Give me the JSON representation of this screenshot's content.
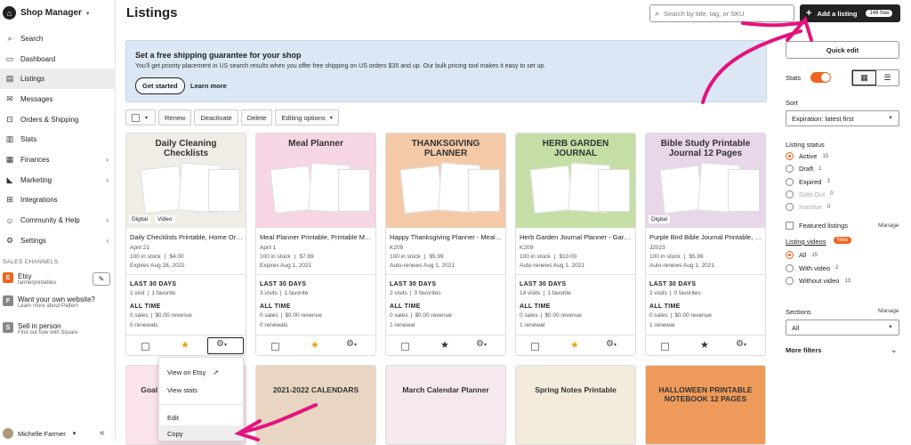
{
  "sidebar": {
    "app_name": "Shop Manager",
    "items": [
      {
        "label": "Search",
        "icon": "search-icon",
        "glyph": "⌕"
      },
      {
        "label": "Dashboard",
        "icon": "dashboard-icon",
        "glyph": "▭"
      },
      {
        "label": "Listings",
        "icon": "listings-icon",
        "glyph": "▤",
        "active": true
      },
      {
        "label": "Messages",
        "icon": "messages-icon",
        "glyph": "✉"
      },
      {
        "label": "Orders & Shipping",
        "icon": "orders-icon",
        "glyph": "⊡"
      },
      {
        "label": "Stats",
        "icon": "stats-icon",
        "glyph": "▥"
      },
      {
        "label": "Finances",
        "icon": "finances-icon",
        "glyph": "▦",
        "chevron": true
      },
      {
        "label": "Marketing",
        "icon": "marketing-icon",
        "glyph": "◣",
        "chevron": true
      },
      {
        "label": "Integrations",
        "icon": "integrations-icon",
        "glyph": "⊞"
      },
      {
        "label": "Community & Help",
        "icon": "community-icon",
        "glyph": "☺",
        "chevron": true
      },
      {
        "label": "Settings",
        "icon": "settings-icon",
        "glyph": "⚙",
        "chevron": true
      }
    ],
    "sales_channels_label": "SALES CHANNELS",
    "channels": [
      {
        "badge": "E",
        "color": "#f1641e",
        "title": "Etsy",
        "sub": "farmerprintables"
      },
      {
        "badge": "F",
        "color": "#888888",
        "title": "Want your own website?",
        "sub": "Learn more about Pattern"
      },
      {
        "badge": "S",
        "color": "#888888",
        "title": "Sell in person",
        "sub": "Find out how with Square"
      }
    ],
    "edit_glyph": "✎",
    "user_name": "Michelle Farmer",
    "user_caret": "▾",
    "collapse_glyph": "«"
  },
  "header": {
    "title": "Listings",
    "search_placeholder": "Search by title, tag, or SKU",
    "add_label": "Add a listing",
    "add_badge": "146 free"
  },
  "banner": {
    "heading": "Set a free shipping guarantee for your shop",
    "text": "You'll get priority placement in US search results when you offer free shipping on US orders $35 and up. Our bulk pricing tool makes it easy to set up.",
    "primary": "Get started",
    "secondary": "Learn more"
  },
  "toolbar": {
    "renew": "Renew",
    "deactivate": "Deactivate",
    "delete": "Delete",
    "editing": "Editing options"
  },
  "labels": {
    "last30": "LAST 30 DAYS",
    "alltime": "ALL TIME"
  },
  "listings": [
    {
      "title": "Daily Checklists Printable, Home Organization",
      "date": "April 21",
      "stock": "100 in stock",
      "price": "$4.00",
      "renew": "Expires Aug 28, 2021",
      "visits": "1 visit",
      "fav": "1 favorite",
      "sales": "0 sales",
      "revenue": "$0.00 revenue",
      "renewals": "0 renewals",
      "starred": true,
      "tags": [
        "Digital",
        "Video"
      ],
      "bg": "#f0ece6",
      "img_text": "Daily Cleaning Checklists"
    },
    {
      "title": "Meal Planner Printable, Printable Meal Planner",
      "date": "April 1",
      "stock": "100 in stock",
      "price": "$7.99",
      "renew": "Expires Aug 1, 2021",
      "visits": "3 visits",
      "fav": "1 favorite",
      "sales": "0 sales",
      "revenue": "$0.00 revenue",
      "renewals": "0 renewals",
      "starred": true,
      "tags": [],
      "bg": "#f6d5e4",
      "img_text": "Meal Planner"
    },
    {
      "title": "Happy Thanksgiving Planner - Meal Planning",
      "date": "K209",
      "stock": "100 in stock",
      "price": "$5.99",
      "renew": "Auto-renews Aug 1, 2021",
      "visits": "2 visits",
      "fav": "0 favorites",
      "sales": "0 sales",
      "revenue": "$0.00 revenue",
      "renewals": "1 renewal",
      "starred": false,
      "tags": [],
      "bg": "#f3c9a8",
      "img_text": "THANKSGIVING PLANNER"
    },
    {
      "title": "Herb Garden Journal Planner - Garden Printable",
      "date": "K209",
      "stock": "100 in stock",
      "price": "$10.00",
      "renew": "Auto-renews Aug 1, 2021",
      "visits": "14 visits",
      "fav": "1 favorite",
      "sales": "0 sales",
      "revenue": "$0.00 revenue",
      "renewals": "1 renewal",
      "starred": true,
      "tags": [],
      "bg": "#c4dea6",
      "img_text": "HERB GARDEN JOURNAL"
    },
    {
      "title": "Purple Bird Bible Journal Printable, Study",
      "date": "J2023",
      "stock": "100 in stock",
      "price": "$5.99",
      "renew": "Auto-renews Aug 1, 2021",
      "visits": "2 visits",
      "fav": "0 favorites",
      "sales": "0 sales",
      "revenue": "$0.00 revenue",
      "renewals": "1 renewal",
      "starred": false,
      "tags": [
        "Digital"
      ],
      "bg": "#e8d7e8",
      "img_text": "Bible Study Printable Journal 12 Pages"
    }
  ],
  "row2": [
    {
      "bg": "#fbe3ec",
      "text": "Goal Setting Productivity Planner"
    },
    {
      "bg": "#e8d6c2",
      "text": "2021-2022 CALENDARS"
    },
    {
      "bg": "#f5e8ee",
      "text": "March Calendar Planner"
    },
    {
      "bg": "#f3ecdc",
      "text": "Spring Notes Printable"
    },
    {
      "bg": "#ee9a5a",
      "text": "HALLOWEEN PRINTABLE NOTEBOOK 12 PAGES"
    }
  ],
  "menu": {
    "view_on_etsy": "View on Etsy",
    "view_stats": "View stats",
    "edit": "Edit",
    "copy": "Copy"
  },
  "right_panel": {
    "quick_edit": "Quick edit",
    "stats_label": "Stats",
    "sort_label": "Sort",
    "sort_value": "Expiration: latest first",
    "status_label": "Listing status",
    "statuses": [
      {
        "label": "Active",
        "count": "15",
        "checked": true,
        "disabled": false
      },
      {
        "label": "Draft",
        "count": "1",
        "checked": false,
        "disabled": false
      },
      {
        "label": "Expired",
        "count": "3",
        "checked": false,
        "disabled": false
      },
      {
        "label": "Sold Out",
        "count": "0",
        "checked": false,
        "disabled": true
      },
      {
        "label": "Inactive",
        "count": "0",
        "checked": false,
        "disabled": true
      }
    ],
    "featured_label": "Featured listings",
    "manage": "Manage",
    "videos_label": "Listing videos",
    "new_badge": "New",
    "videos": [
      {
        "label": "All",
        "count": "15",
        "checked": true
      },
      {
        "label": "With video",
        "count": "2",
        "checked": false
      },
      {
        "label": "Without video",
        "count": "13",
        "checked": false
      }
    ],
    "sections_label": "Sections",
    "sections_value": "All",
    "more_filters": "More filters"
  },
  "colors": {
    "accent": "#f1641e",
    "annotation": "#e3137d",
    "banner": "#dbe7f5"
  }
}
